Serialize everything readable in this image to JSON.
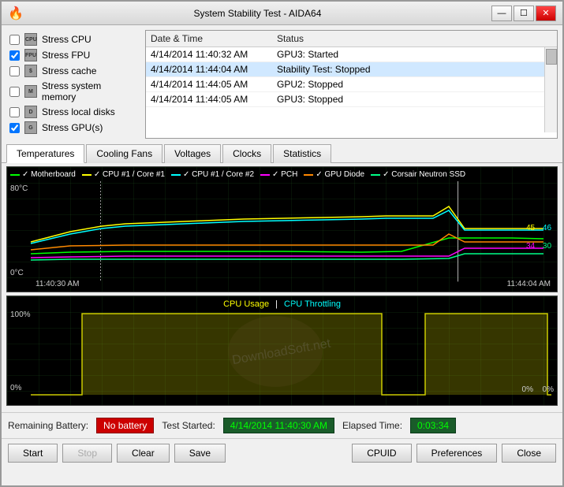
{
  "titleBar": {
    "title": "System Stability Test - AIDA64",
    "icon": "🔥"
  },
  "titleBtns": {
    "minimize": "—",
    "maximize": "☐",
    "close": "✕"
  },
  "checkboxes": [
    {
      "id": "stress-cpu",
      "label": "Stress CPU",
      "checked": false,
      "icon": "cpu"
    },
    {
      "id": "stress-fpu",
      "label": "Stress FPU",
      "checked": true,
      "icon": "fpu"
    },
    {
      "id": "stress-cache",
      "label": "Stress cache",
      "checked": false,
      "icon": "cache"
    },
    {
      "id": "stress-memory",
      "label": "Stress system memory",
      "checked": false,
      "icon": "memory"
    },
    {
      "id": "stress-disks",
      "label": "Stress local disks",
      "checked": false,
      "icon": "disk"
    },
    {
      "id": "stress-gpu",
      "label": "Stress GPU(s)",
      "checked": true,
      "icon": "gpu"
    }
  ],
  "logTable": {
    "headers": [
      "Date & Time",
      "Status"
    ],
    "rows": [
      {
        "date": "4/14/2014 11:40:32 AM",
        "status": "GPU3: Started",
        "highlighted": false
      },
      {
        "date": "4/14/2014 11:44:04 AM",
        "status": "Stability Test: Stopped",
        "highlighted": true
      },
      {
        "date": "4/14/2014 11:44:05 AM",
        "status": "GPU2: Stopped",
        "highlighted": false
      },
      {
        "date": "4/14/2014 11:44:05 AM",
        "status": "GPU3: Stopped",
        "highlighted": false
      }
    ]
  },
  "tabs": [
    {
      "id": "temperatures",
      "label": "Temperatures",
      "active": true
    },
    {
      "id": "cooling-fans",
      "label": "Cooling Fans",
      "active": false
    },
    {
      "id": "voltages",
      "label": "Voltages",
      "active": false
    },
    {
      "id": "clocks",
      "label": "Clocks",
      "active": false
    },
    {
      "id": "statistics",
      "label": "Statistics",
      "active": false
    }
  ],
  "tempChart": {
    "yTop": "80°C",
    "yBottom": "0°C",
    "xLeft": "11:40:30 AM",
    "xRight": "11:44:04 AM",
    "legend": [
      {
        "label": "Motherboard",
        "color": "#00ff00"
      },
      {
        "label": "CPU #1 / Core #1",
        "color": "#ffff00"
      },
      {
        "label": "CPU #1 / Core #2",
        "color": "#00ffff"
      },
      {
        "label": "PCH",
        "color": "#ff00ff"
      },
      {
        "label": "GPU Diode",
        "color": "#ff8800"
      },
      {
        "label": "Corsair Neutron SSD",
        "color": "#00ff88"
      }
    ],
    "values": [
      {
        "label": "45",
        "color": "#ffff00"
      },
      {
        "label": "46",
        "color": "#00ffff"
      },
      {
        "label": "34",
        "color": "#ff00ff"
      },
      {
        "label": "30",
        "color": "#00ff00"
      }
    ]
  },
  "cpuChart": {
    "usageLabel": "CPU Usage",
    "throttleLabel": "CPU Throttling",
    "separator": "|",
    "yTop": "100%",
    "yBottom": "0%",
    "xRight1": "0%",
    "xRight2": "0%"
  },
  "bottomBar": {
    "batteryLabel": "Remaining Battery:",
    "batteryValue": "No battery",
    "testStartedLabel": "Test Started:",
    "testStartedValue": "4/14/2014 11:40:30 AM",
    "elapsedLabel": "Elapsed Time:",
    "elapsedValue": "0:03:34"
  },
  "actionButtons": {
    "start": "Start",
    "stop": "Stop",
    "clear": "Clear",
    "save": "Save",
    "cpuid": "CPUID",
    "preferences": "Preferences",
    "close": "Close"
  },
  "watermark": "DownloadSoft.net"
}
